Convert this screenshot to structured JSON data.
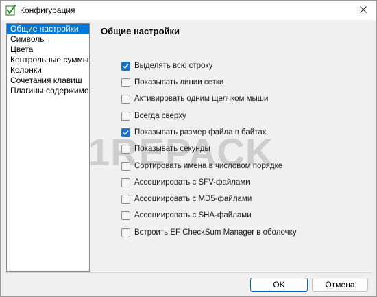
{
  "window": {
    "title": "Конфигурация",
    "app_icon": "checkmark-app-icon",
    "close_icon": "close-icon"
  },
  "sidebar": {
    "items": [
      {
        "label": "Общие настройки",
        "selected": true
      },
      {
        "label": "Символы",
        "selected": false
      },
      {
        "label": "Цвета",
        "selected": false
      },
      {
        "label": "Контрольные суммы",
        "selected": false
      },
      {
        "label": "Колонки",
        "selected": false
      },
      {
        "label": "Сочетания клавиш",
        "selected": false
      },
      {
        "label": "Плагины содержимог",
        "selected": false
      }
    ]
  },
  "panel": {
    "title": "Общие настройки",
    "options": [
      {
        "label": "Выделять всю строку",
        "checked": true
      },
      {
        "label": "Показывать линии сетки",
        "checked": false
      },
      {
        "label": "Активировать одним щелчком мыши",
        "checked": false
      },
      {
        "label": "Всегда сверху",
        "checked": false
      },
      {
        "label": "Показывать размер файла в байтах",
        "checked": true
      },
      {
        "label": "Показывать секунды",
        "checked": false
      },
      {
        "label": "Сортировать имена в числовом порядке",
        "checked": false
      },
      {
        "label": "Ассоциировать с SFV-файлами",
        "checked": false
      },
      {
        "label": "Ассоциировать с MD5-файлами",
        "checked": false
      },
      {
        "label": "Ассоциировать с SHA-файлами",
        "checked": false
      },
      {
        "label": "Встроить EF CheckSum Manager в оболочку",
        "checked": false
      }
    ]
  },
  "watermark": "1REPACK",
  "buttons": {
    "ok_label": "OK",
    "cancel_label": "Отмена"
  },
  "colors": {
    "accent": "#0078d7",
    "checkbox_checked": "#1a73c7"
  }
}
